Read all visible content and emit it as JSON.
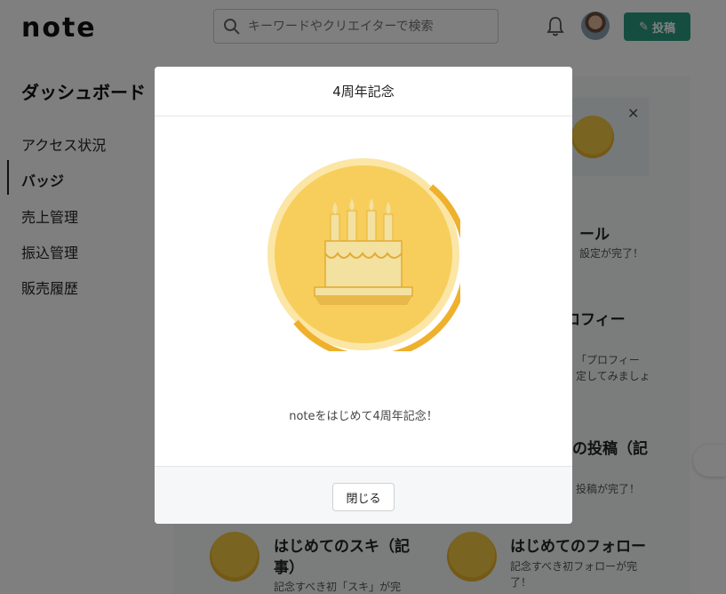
{
  "header": {
    "logo": "note",
    "search_placeholder": "キーワードやクリエイターで検索",
    "post_label": "投稿"
  },
  "sidebar": {
    "title": "ダッシュボード",
    "items": [
      {
        "label": "アクセス状況",
        "active": false
      },
      {
        "label": "バッジ",
        "active": true
      },
      {
        "label": "売上管理",
        "active": false
      },
      {
        "label": "振込管理",
        "active": false
      },
      {
        "label": "販売履歴",
        "active": false
      }
    ]
  },
  "background": {
    "partial_1_title": "ール",
    "partial_1_desc": "設定が完了！",
    "partial_2_title": "ロフィー",
    "partial_2_desc_1": "「プロフィー",
    "partial_2_desc_2": "定してみましょ",
    "partial_3_title": "の投稿（記",
    "partial_3_desc": "投稿が完了！",
    "card_like_title_1": "はじめてのスキ（記",
    "card_like_title_2": "事）",
    "card_like_desc": "記念すべき初「スキ」が完",
    "card_follow_title": "はじめてのフォロー",
    "card_follow_desc_1": "記念すべき初フォローが完",
    "card_follow_desc_2": "了！"
  },
  "modal": {
    "title": "4周年記念",
    "message": "noteをはじめて4周年記念！",
    "close_label": "閉じる",
    "badge_icon": "birthday-cake-icon"
  },
  "colors": {
    "accent": "#2a9c80",
    "badge_gold": "#f7ce5c",
    "badge_ring": "#efb02c"
  }
}
